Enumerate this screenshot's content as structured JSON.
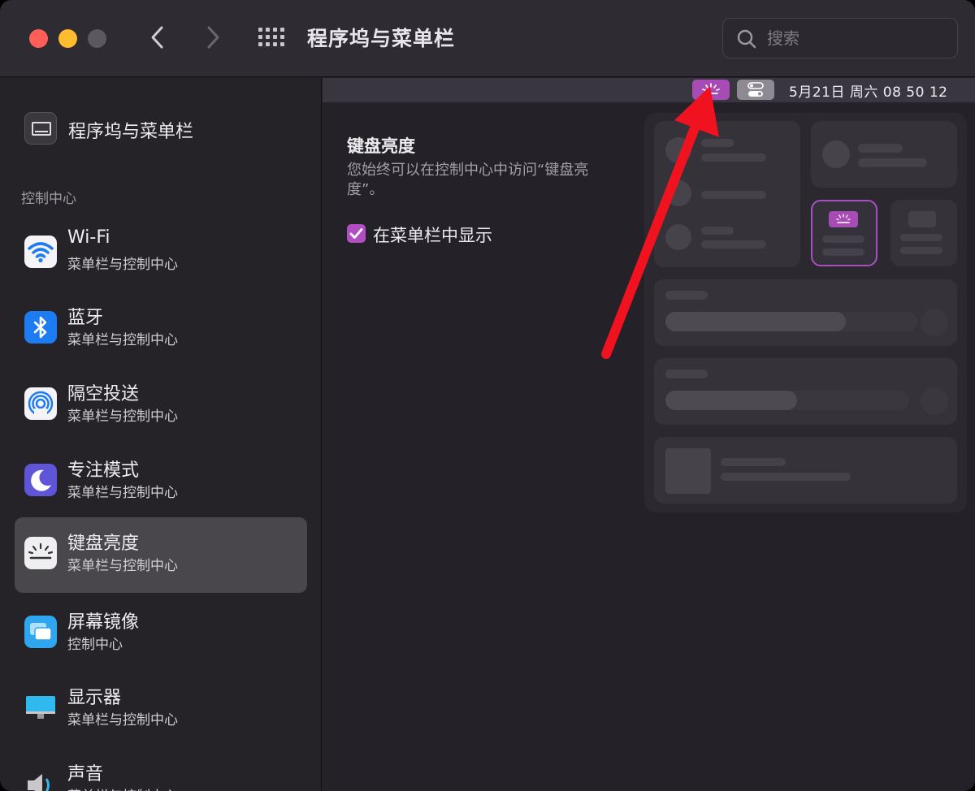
{
  "window": {
    "title": "程序坞与菜单栏",
    "search_placeholder": "搜索"
  },
  "sidebar": {
    "top_item": {
      "label": "程序坞与菜单栏",
      "icon": "dock-menubar-icon"
    },
    "section_label": "控制中心",
    "items": [
      {
        "name": "Wi-Fi",
        "sub": "菜单栏与控制中心",
        "icon": "wifi-icon",
        "selected": false
      },
      {
        "name": "蓝牙",
        "sub": "菜单栏与控制中心",
        "icon": "bluetooth-icon",
        "selected": false
      },
      {
        "name": "隔空投送",
        "sub": "菜单栏与控制中心",
        "icon": "airdrop-icon",
        "selected": false
      },
      {
        "name": "专注模式",
        "sub": "菜单栏与控制中心",
        "icon": "focus-moon-icon",
        "selected": false
      },
      {
        "name": "键盘亮度",
        "sub": "菜单栏与控制中心",
        "icon": "keyboard-brightness-icon",
        "selected": true
      },
      {
        "name": "屏幕镜像",
        "sub": "控制中心",
        "icon": "screen-mirroring-icon",
        "selected": false
      },
      {
        "name": "显示器",
        "sub": "菜单栏与控制中心",
        "icon": "display-icon",
        "selected": false
      },
      {
        "name": "声音",
        "sub": "菜单栏与控制中心",
        "icon": "sound-icon",
        "selected": false
      }
    ]
  },
  "menubar_preview": {
    "clock": "5月21日 周六  08 50 12",
    "keyboard_icon_color": "#a74bb5"
  },
  "main": {
    "section_title": "键盘亮度",
    "section_desc": "您始终可以在控制中心中访问“键盘亮度”。",
    "checkbox_label": "在菜单栏中显示",
    "checkbox_checked": true
  },
  "colors": {
    "accent": "#b14fc2",
    "annotation_arrow": "#f0121e"
  }
}
